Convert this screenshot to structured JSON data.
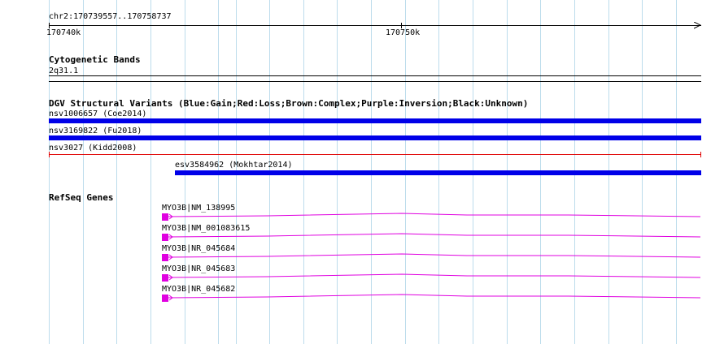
{
  "coords": {
    "region": "chr2:170739557..170758737",
    "tick_left": "170740k",
    "tick_mid": "170750k"
  },
  "cyto": {
    "title": "Cytogenetic Bands",
    "band": "2q31.1"
  },
  "dgv": {
    "title": "DGV Structural Variants (Blue:Gain;Red:Loss;Brown:Complex;Purple:Inversion;Black:Unknown)",
    "variants": [
      {
        "label": "nsv1006657 (Coe2014)",
        "type": "gain",
        "color": "#0000e8"
      },
      {
        "label": "nsv3169822 (Fu2018)",
        "type": "gain",
        "color": "#0000e8"
      },
      {
        "label": "nsv3027 (Kidd2008)",
        "type": "loss",
        "color": "#e00000"
      },
      {
        "label": "esv3584962 (Mokhtar2014)",
        "type": "gain",
        "color": "#0000e8"
      }
    ]
  },
  "refseq": {
    "title": "RefSeq Genes",
    "color": "#e000e0",
    "genes": [
      {
        "label": "MYO3B|NM_138995"
      },
      {
        "label": "MYO3B|NM_001083615"
      },
      {
        "label": "MYO3B|NR_045684"
      },
      {
        "label": "MYO3B|NR_045683"
      },
      {
        "label": "MYO3B|NR_045682"
      }
    ]
  },
  "colors": {
    "grid": "#bcdcec",
    "gain": "#0000e8",
    "loss": "#e00000",
    "gene": "#e000e0"
  }
}
